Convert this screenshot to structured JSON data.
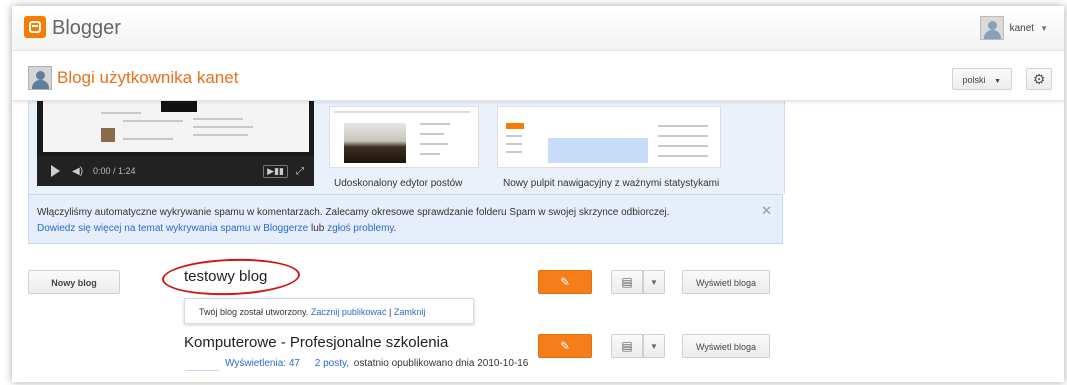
{
  "header": {
    "brand": "Blogger",
    "user_name": "kanet"
  },
  "titlebar": {
    "title": "Blogi użytkownika kanet",
    "language": "polski"
  },
  "promo": {
    "video_time": "0:00 / 1:24",
    "feature1_label": "Udoskonalony edytor postów",
    "feature2_label": "Nowy pulpit nawigacyjny z ważnymi statystykami"
  },
  "notice": {
    "line1": "Włączyliśmy automatyczne wykrywanie spamu w komentarzach. Zalecamy okresowe sprawdzanie folderu Spam w swojej skrzynce odbiorczej.",
    "learn_more_link": "Dowiedz się więcej na temat wykrywania spamu w Bloggerze",
    "connector": "lub",
    "report_link": "zgłoś problemy",
    "period": "."
  },
  "blogs": {
    "new_blog_label": "Nowy blog",
    "view_label": "Wyświetl bloga",
    "items": [
      {
        "title": "testowy blog",
        "tooltip_text": "Twój blog został utworzony.",
        "tooltip_start": "Zacznij publikować",
        "tooltip_sep": "|",
        "tooltip_close": "Zamknij"
      },
      {
        "title": "Komputerowe - Profesjonalne szkolenia",
        "views": "Wyświetlenia: 47",
        "posts": "2 posty,",
        "last_published": "ostatnio opublikowano dnia 2010-10-16"
      }
    ]
  },
  "colors": {
    "accent_orange": "#f57d1a",
    "title_orange": "#e8701a",
    "link_blue": "#2a6bd1",
    "annotation_red": "#d21616"
  },
  "icons": {
    "logo": "blogger-logo-icon",
    "settings": "gear-icon",
    "edit": "pencil-icon",
    "posts": "clipboard-icon",
    "close": "close-icon"
  }
}
